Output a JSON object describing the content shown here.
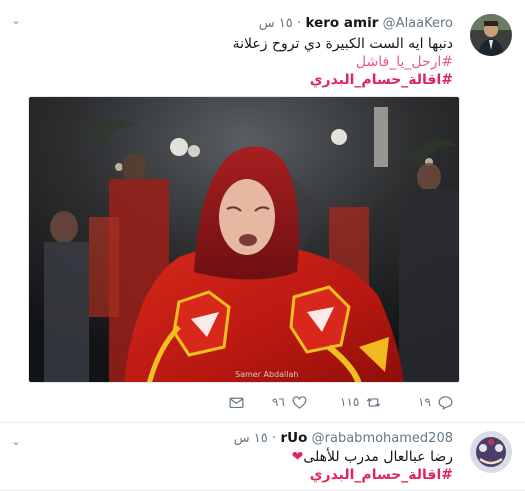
{
  "tweet1": {
    "name": "kero amir",
    "handle": "@AlaaKero",
    "time": "١٥ س",
    "text": "دنبها ايه الست الكبيرة دي تروح زعلانة",
    "hashtag1": "#ارحل_يا_فاشل",
    "hashtag2": "#اقالة_حسام_البدري",
    "photo_credit": "Samer Abdallah",
    "replies": "١٩",
    "retweets": "١١٥",
    "likes": "٩٦"
  },
  "tweet2": {
    "name": "rUo",
    "handle": "@rababmohamed208",
    "time": "١٥ س",
    "text": "رضا عبالعال مدرب للأهلى",
    "heart": "❤",
    "hashtag": "#اقالة_حسام_البدري"
  },
  "colors": {
    "hashtag": "#e0245e",
    "secondary_text": "#657786",
    "border": "#e6ecf0"
  }
}
